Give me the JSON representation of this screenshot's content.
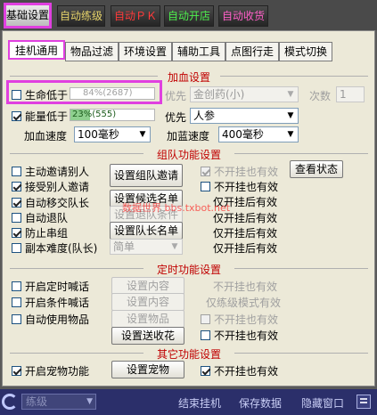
{
  "top_tabs": [
    {
      "label": "基础设置",
      "color": "#000000"
    },
    {
      "label": "自动练级",
      "color": "#e6d36a"
    },
    {
      "label": "自动ＰＫ",
      "color": "#ff3a3a"
    },
    {
      "label": "自动开店",
      "color": "#4ef04e"
    },
    {
      "label": "自动收货",
      "color": "#ff5fc8"
    }
  ],
  "sub_tabs": [
    "挂机通用",
    "物品过滤",
    "环境设置",
    "辅助工具",
    "点图行走",
    "模式切换"
  ],
  "sections": {
    "heal": "加血设置",
    "team": "组队功能设置",
    "timed": "定时功能设置",
    "other": "其它功能设置"
  },
  "heal": {
    "life_low_label": "生命低于",
    "life_progress_text": "84%(2687)",
    "life_progress_value": 0.84,
    "life_priority_label": "优先",
    "life_priority_value": "金创药(小)",
    "count_label": "次数",
    "count_value": "1",
    "energy_low_label": "能量低于",
    "energy_progress_text": "23%(555)",
    "energy_progress_value": 0.23,
    "energy_priority_label": "优先",
    "energy_priority_value": "人参",
    "hp_speed_label": "加血速度",
    "hp_speed_value": "100毫秒",
    "mp_speed_label": "加蓝速度",
    "mp_speed_value": "400毫秒"
  },
  "team": {
    "invite_others": "主动邀请别人",
    "accept_invite": "接受别人邀请",
    "auto_transfer_leader": "自动移交队长",
    "auto_leave": "自动退队",
    "anti_cross_group": "防止串组",
    "dungeon_difficulty": "副本难度(队长)",
    "btn_set_invite": "设置组队邀请",
    "btn_set_candidates": "设置候选名单",
    "btn_set_leave_condition": "设置退队条件",
    "btn_set_leader_list": "设置队长名单",
    "difficulty_value": "简单",
    "no_hook_valid_1": "不开挂也有效",
    "btn_view_status": "查看状态",
    "no_hook_valid_2": "不开挂也有效",
    "leader_only_1": "仅开挂后有效",
    "leader_only_2": "仅开挂后有效",
    "leader_only_3": "仅开挂后有效",
    "leader_only_4": "仅开挂后有效"
  },
  "timed": {
    "timed_shout": "开启定时喊话",
    "cond_shout": "开启条件喊话",
    "auto_use_item": "自动使用物品",
    "btn_content_1": "设置内容",
    "btn_content_2": "设置内容",
    "btn_items": "设置物品",
    "btn_send_flowers": "设置送收花",
    "note_1": "不开挂也有效",
    "note_2": "仅练级模式有效",
    "note_3": "不开挂也有效",
    "note_4": "不开挂也有效"
  },
  "other": {
    "pet_function": "开启宠物功能",
    "btn_set_pet": "设置宠物",
    "no_hook_valid": "不开挂也有效"
  },
  "watermark": "数据世界 bbs.txbot.net",
  "bottom": {
    "mode_value": "练级",
    "stop_hook": "结束挂机",
    "save_data": "保存数据",
    "hide_window": "隐藏窗口"
  }
}
